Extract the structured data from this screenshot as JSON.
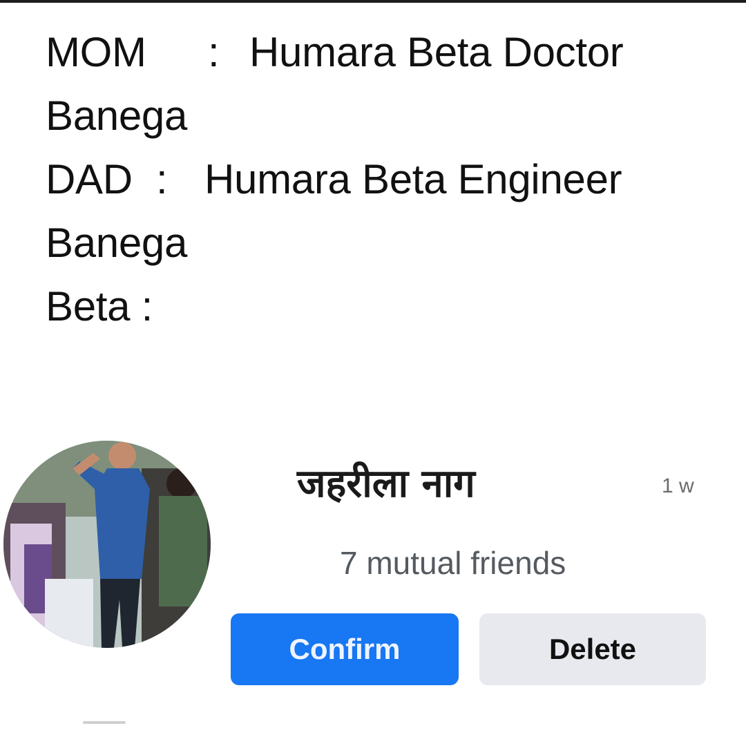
{
  "meme": {
    "mom": {
      "speaker": "MOM",
      "sep": ":",
      "text": "Humara Beta Doctor",
      "cont": "Banega"
    },
    "dad": {
      "speaker": "DAD",
      "sep": ":",
      "text": "Humara Beta Engineer",
      "cont": "Banega"
    },
    "beta": {
      "speaker": "Beta",
      "sep": ":"
    }
  },
  "friend_request": {
    "name": "जहरीला नाग",
    "time": "1 w",
    "mutual": "7 mutual friends",
    "confirm_label": "Confirm",
    "delete_label": "Delete",
    "avatar_icon": "profile-photo"
  },
  "colors": {
    "confirm_bg": "#1877f2",
    "delete_bg": "#e8e9ee",
    "secondary_text": "#555a60"
  }
}
